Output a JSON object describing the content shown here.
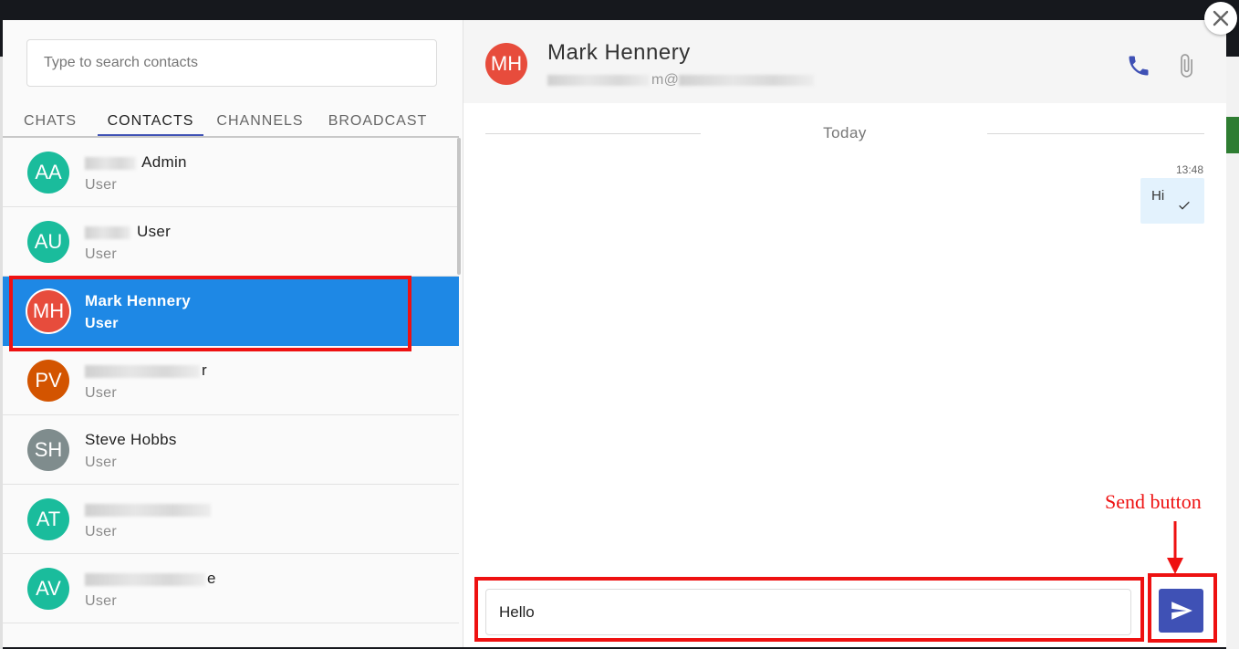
{
  "search": {
    "placeholder": "Type to search contacts",
    "value": ""
  },
  "tabs": [
    {
      "label": "CHATS",
      "active": false
    },
    {
      "label": "CONTACTS",
      "active": true
    },
    {
      "label": "CHANNELS",
      "active": false
    },
    {
      "label": "BROADCAST",
      "active": false
    }
  ],
  "contacts": [
    {
      "initials": "AA",
      "name_visible": "Admin",
      "role": "User",
      "color": "#1abc9c",
      "selected": false
    },
    {
      "initials": "AU",
      "name_visible": "User",
      "role": "User",
      "color": "#1abc9c",
      "selected": false
    },
    {
      "initials": "MH",
      "name": "Mark Hennery",
      "role": "User",
      "color": "#e74c3c",
      "selected": true
    },
    {
      "initials": "PV",
      "name_visible": "r",
      "role": "User",
      "color": "#d35400",
      "selected": false
    },
    {
      "initials": "SH",
      "name": "Steve Hobbs",
      "role": "User",
      "color": "#7f8c8d",
      "selected": false
    },
    {
      "initials": "AT",
      "name_visible": "",
      "role": "User",
      "color": "#1abc9c",
      "selected": false
    },
    {
      "initials": "AV",
      "name_visible": "e",
      "role": "User",
      "color": "#1abc9c",
      "selected": false
    }
  ],
  "chat": {
    "initials": "MH",
    "name": "Mark Hennery",
    "email_visible": "m@",
    "day_label": "Today",
    "messages": [
      {
        "time": "13:48",
        "text": "Hi",
        "status": "sent-check-icon"
      }
    ],
    "composer_value": "Hello"
  },
  "annotation": {
    "label": "Send button"
  },
  "colors": {
    "accent": "#3f51b5",
    "selected_row": "#1e88e5",
    "annotation": "#ee1111",
    "bubble": "#e3f2fd"
  },
  "icons": [
    "phone-icon",
    "paperclip-icon",
    "send-icon",
    "close-icon",
    "check-icon"
  ]
}
